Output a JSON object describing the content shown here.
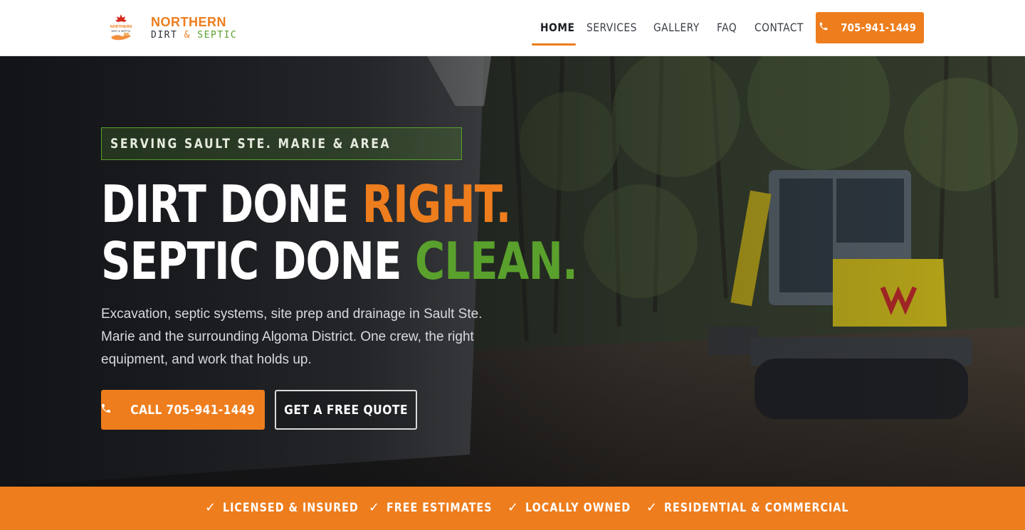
{
  "brand": {
    "name_line1": "NORTHERN",
    "name_line2_a": "DIRT",
    "name_line2_amp": "&",
    "name_line2_b": "SEPTIC",
    "logo_icon": "maple-leaf-excavator-logo",
    "mini_logo_line1": "NORTHERN",
    "mini_logo_line2": "DIRT & SEPTIC"
  },
  "nav": {
    "items": [
      {
        "label": "HOME",
        "active": true
      },
      {
        "label": "SERVICES",
        "active": false
      },
      {
        "label": "GALLERY",
        "active": false
      },
      {
        "label": "FAQ",
        "active": false
      },
      {
        "label": "CONTACT",
        "active": false
      }
    ],
    "cta_label": "705-941-1449",
    "cta_icon": "phone-icon"
  },
  "hero": {
    "eyebrow": "SERVING SAULT STE. MARIE & AREA",
    "headline_line1_a": "DIRT DONE ",
    "headline_line1_b": "RIGHT.",
    "headline_line2_a": "SEPTIC DONE ",
    "headline_line2_b": "CLEAN.",
    "lead": "Excavation, septic systems, site prep and drainage in Sault Ste. Marie and the surrounding Algoma District. One crew, the right equipment, and work that holds up.",
    "primary_button": "CALL 705-941-1449",
    "secondary_button": "GET A FREE QUOTE"
  },
  "trust_bar": {
    "items": [
      "LICENSED & INSURED",
      "FREE ESTIMATES",
      "LOCALLY OWNED",
      "RESIDENTIAL & COMMERCIAL"
    ],
    "icon": "check-icon"
  },
  "colors": {
    "accent_orange": "#ee7d1d",
    "accent_green": "#5aa02c",
    "dark_text": "#1c1f25",
    "white": "#ffffff"
  }
}
